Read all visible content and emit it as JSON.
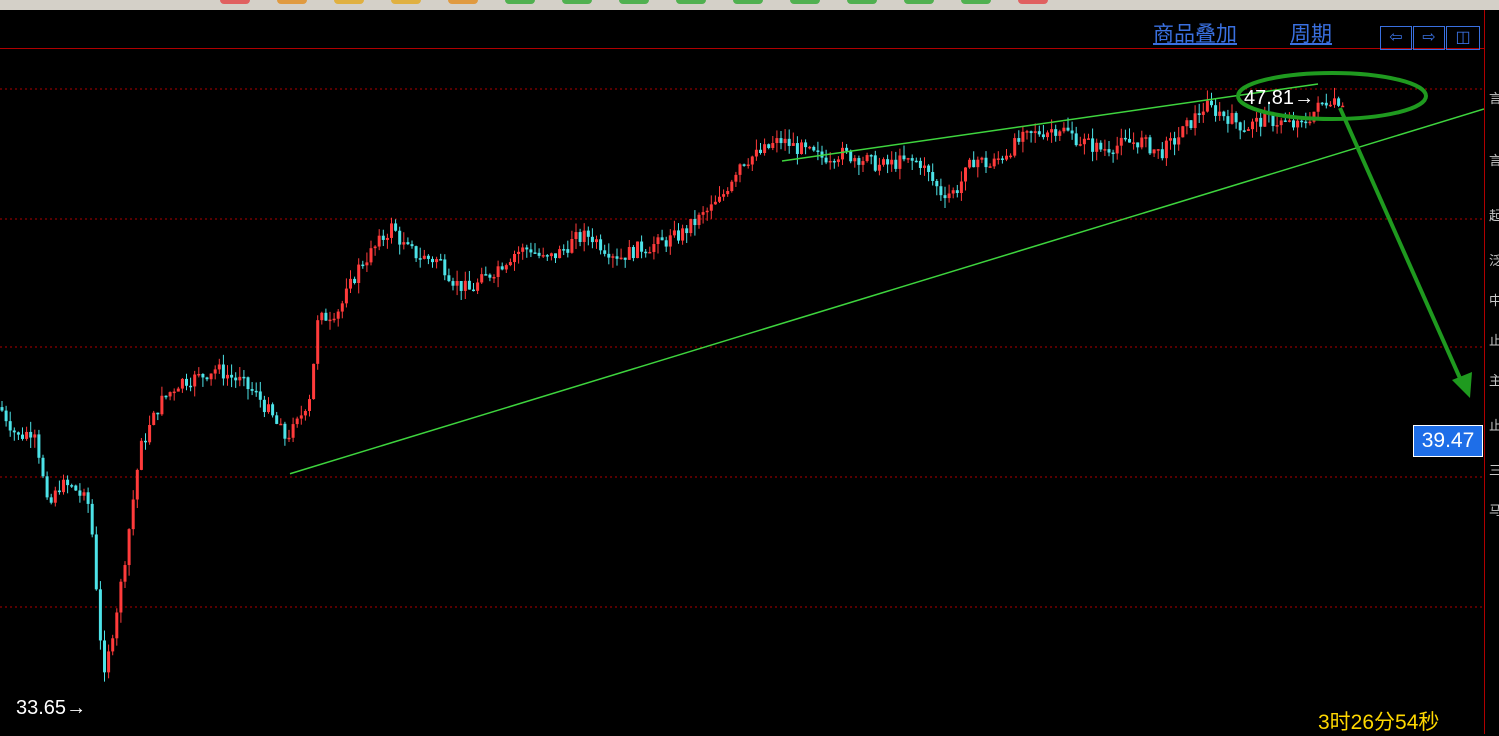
{
  "toolbar": {
    "swatches": [
      "#e06060",
      "#e09a40",
      "#e0b040",
      "#e0b040",
      "#e09a40",
      "#50b050",
      "#50b050",
      "#50b050",
      "#50b050",
      "#50b050",
      "#50b050",
      "#50b050",
      "#50b050",
      "#50b050",
      "#e06060"
    ]
  },
  "topbar": {
    "overlay_label": "商品叠加",
    "period_label": "周期",
    "nav_left": "⇦",
    "nav_right": "⇨",
    "nav_grid": "◫"
  },
  "chart": {
    "high_label": "47.81",
    "low_label": "33.65",
    "arrow": "→",
    "current_price": "39.47",
    "countdown": "3时26分54秒",
    "colors": {
      "up": "#ff3b3b",
      "down": "#4de3e8",
      "trendline": "#3ed43e",
      "annotation": "#1f9a1f",
      "grid": "#b00000"
    }
  },
  "chart_data": {
    "type": "candlestick",
    "price_range": [
      33.65,
      47.81
    ],
    "upper_trendline": "resistance",
    "lower_trendline": "support",
    "annotation": "circle at high with downward arrow"
  },
  "sidebar": {
    "marks": [
      "言",
      "言",
      "起",
      "泛",
      "中",
      "止",
      "主",
      "止",
      "三",
      "马"
    ]
  }
}
